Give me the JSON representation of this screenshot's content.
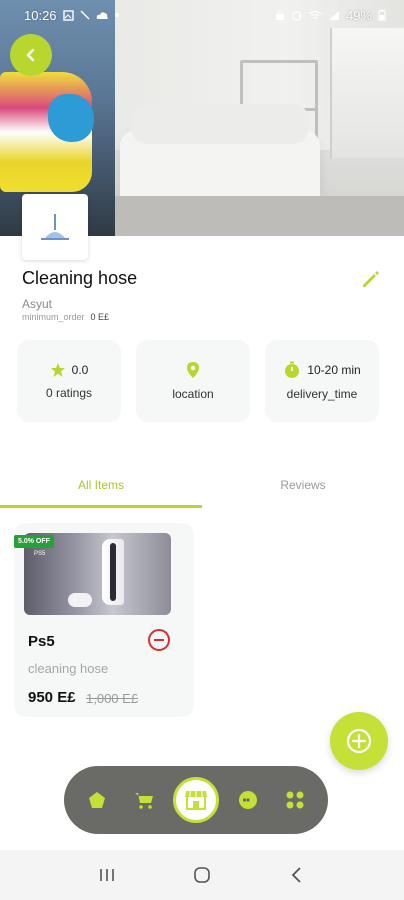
{
  "status_bar": {
    "time": "10:26",
    "battery": "49%"
  },
  "store": {
    "name": "Cleaning hose",
    "city": "Asyut",
    "min_order_label": "minimum_order",
    "min_order_value": "0 E£"
  },
  "info_cards": [
    {
      "icon": "star-icon",
      "top": "0.0",
      "bottom": "0 ratings"
    },
    {
      "icon": "location-pin-icon",
      "top": "",
      "bottom": "location"
    },
    {
      "icon": "timer-icon",
      "top": "10-20 min",
      "bottom": "delivery_time"
    }
  ],
  "tabs": [
    {
      "label": "All Items",
      "active": true
    },
    {
      "label": "Reviews",
      "active": false
    }
  ],
  "product": {
    "badge": "5.0% OFF",
    "image_text": "PS5",
    "name": "Ps5",
    "subtitle": "cleaning hose",
    "price": "950 E£",
    "old_price": "1,000 E£"
  },
  "bottom_nav": {
    "items": [
      "home-icon",
      "cart-icon",
      "store-icon",
      "chat-icon",
      "grid-icon"
    ],
    "active": "store-icon"
  },
  "colors": {
    "accent": "#b9d62f",
    "remove": "#d8302f",
    "badge": "#27a03a",
    "nav_bg": "#6a6a66"
  }
}
